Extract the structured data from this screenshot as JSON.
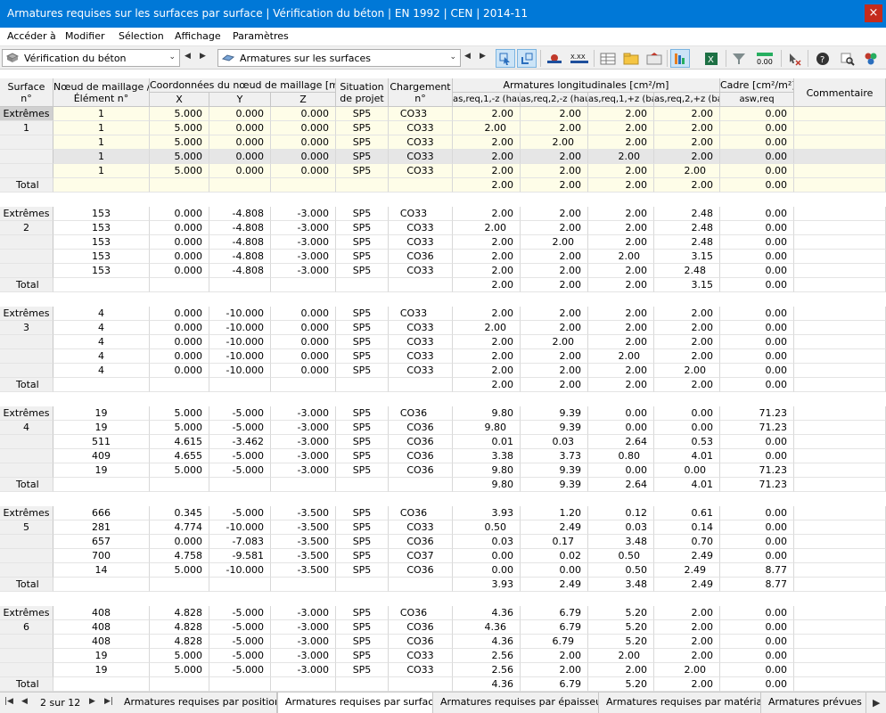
{
  "window": {
    "title": "Armatures requises sur les surfaces par surface | Vérification du béton | EN 1992 | CEN | 2014-11",
    "close": "×"
  },
  "menu": [
    "Accéder à",
    "Modifier",
    "Sélection",
    "Affichage",
    "Paramètres"
  ],
  "toolbar": {
    "module": "Vérification du béton",
    "result": "Armatures sur les surfaces",
    "prev": "◀",
    "next": "▶",
    "dropdown": "⌄",
    "xxx": "X.XX",
    "zero": "0.00"
  },
  "columns": {
    "surface": [
      "Surface",
      "n°"
    ],
    "node": [
      "Nœud de maillage /",
      "Élément n°"
    ],
    "coords_group": "Coordonnées du nœud de maillage [m]",
    "x": "X",
    "y": "Y",
    "z": "Z",
    "situation": [
      "Situation",
      "de projet"
    ],
    "loading": [
      "Chargement",
      "n°"
    ],
    "long_group": "Armatures longitudinales [cm²/m]",
    "a1": "as,req,1,-z (haut)",
    "a2": "as,req,2,-z (haut)",
    "a3": "as,req,1,+z (bas)",
    "a4": "as,req,2,+z (bas)",
    "stirrup_group": "Cadre [cm²/m²]",
    "asw": "asw,req",
    "comment": "Commentaire"
  },
  "labels": {
    "extremes": "Extrêmes",
    "total": "Total"
  },
  "groups": [
    {
      "surface": "1",
      "rows": [
        [
          "1",
          "5.000",
          "0.000",
          "0.000",
          "SP5",
          "CO33",
          "2.00",
          "2.00",
          "2.00",
          "2.00",
          "0.00"
        ],
        [
          "1",
          "5.000",
          "0.000",
          "0.000",
          "SP5",
          "CO33",
          "2.00",
          "2.00",
          "2.00",
          "2.00",
          "0.00"
        ],
        [
          "1",
          "5.000",
          "0.000",
          "0.000",
          "SP5",
          "CO33",
          "2.00",
          "2.00",
          "2.00",
          "2.00",
          "0.00"
        ],
        [
          "1",
          "5.000",
          "0.000",
          "0.000",
          "SP5",
          "CO33",
          "2.00",
          "2.00",
          "2.00",
          "2.00",
          "0.00"
        ],
        [
          "1",
          "5.000",
          "0.000",
          "0.000",
          "SP5",
          "CO33",
          "2.00",
          "2.00",
          "2.00",
          "2.00",
          "0.00"
        ]
      ],
      "total": [
        "2.00",
        "2.00",
        "2.00",
        "2.00",
        "0.00"
      ]
    },
    {
      "surface": "2",
      "rows": [
        [
          "153",
          "0.000",
          "-4.808",
          "-3.000",
          "SP5",
          "CO33",
          "2.00",
          "2.00",
          "2.00",
          "2.48",
          "0.00"
        ],
        [
          "153",
          "0.000",
          "-4.808",
          "-3.000",
          "SP5",
          "CO33",
          "2.00",
          "2.00",
          "2.00",
          "2.48",
          "0.00"
        ],
        [
          "153",
          "0.000",
          "-4.808",
          "-3.000",
          "SP5",
          "CO33",
          "2.00",
          "2.00",
          "2.00",
          "2.48",
          "0.00"
        ],
        [
          "153",
          "0.000",
          "-4.808",
          "-3.000",
          "SP5",
          "CO36",
          "2.00",
          "2.00",
          "2.00",
          "3.15",
          "0.00"
        ],
        [
          "153",
          "0.000",
          "-4.808",
          "-3.000",
          "SP5",
          "CO33",
          "2.00",
          "2.00",
          "2.00",
          "2.48",
          "0.00"
        ]
      ],
      "total": [
        "2.00",
        "2.00",
        "2.00",
        "3.15",
        "0.00"
      ]
    },
    {
      "surface": "3",
      "rows": [
        [
          "4",
          "0.000",
          "-10.000",
          "0.000",
          "SP5",
          "CO33",
          "2.00",
          "2.00",
          "2.00",
          "2.00",
          "0.00"
        ],
        [
          "4",
          "0.000",
          "-10.000",
          "0.000",
          "SP5",
          "CO33",
          "2.00",
          "2.00",
          "2.00",
          "2.00",
          "0.00"
        ],
        [
          "4",
          "0.000",
          "-10.000",
          "0.000",
          "SP5",
          "CO33",
          "2.00",
          "2.00",
          "2.00",
          "2.00",
          "0.00"
        ],
        [
          "4",
          "0.000",
          "-10.000",
          "0.000",
          "SP5",
          "CO33",
          "2.00",
          "2.00",
          "2.00",
          "2.00",
          "0.00"
        ],
        [
          "4",
          "0.000",
          "-10.000",
          "0.000",
          "SP5",
          "CO33",
          "2.00",
          "2.00",
          "2.00",
          "2.00",
          "0.00"
        ]
      ],
      "total": [
        "2.00",
        "2.00",
        "2.00",
        "2.00",
        "0.00"
      ]
    },
    {
      "surface": "4",
      "rows": [
        [
          "19",
          "5.000",
          "-5.000",
          "-3.000",
          "SP5",
          "CO36",
          "9.80",
          "9.39",
          "0.00",
          "0.00",
          "71.23"
        ],
        [
          "19",
          "5.000",
          "-5.000",
          "-3.000",
          "SP5",
          "CO36",
          "9.80",
          "9.39",
          "0.00",
          "0.00",
          "71.23"
        ],
        [
          "511",
          "4.615",
          "-3.462",
          "-3.000",
          "SP5",
          "CO36",
          "0.01",
          "0.03",
          "2.64",
          "0.53",
          "0.00"
        ],
        [
          "409",
          "4.655",
          "-5.000",
          "-3.000",
          "SP5",
          "CO36",
          "3.38",
          "3.73",
          "0.80",
          "4.01",
          "0.00"
        ],
        [
          "19",
          "5.000",
          "-5.000",
          "-3.000",
          "SP5",
          "CO36",
          "9.80",
          "9.39",
          "0.00",
          "0.00",
          "71.23"
        ]
      ],
      "total": [
        "9.80",
        "9.39",
        "2.64",
        "4.01",
        "71.23"
      ]
    },
    {
      "surface": "5",
      "rows": [
        [
          "666",
          "0.345",
          "-5.000",
          "-3.500",
          "SP5",
          "CO36",
          "3.93",
          "1.20",
          "0.12",
          "0.61",
          "0.00"
        ],
        [
          "281",
          "4.774",
          "-10.000",
          "-3.500",
          "SP5",
          "CO33",
          "0.50",
          "2.49",
          "0.03",
          "0.14",
          "0.00"
        ],
        [
          "657",
          "0.000",
          "-7.083",
          "-3.500",
          "SP5",
          "CO36",
          "0.03",
          "0.17",
          "3.48",
          "0.70",
          "0.00"
        ],
        [
          "700",
          "4.758",
          "-9.581",
          "-3.500",
          "SP5",
          "CO37",
          "0.00",
          "0.02",
          "0.50",
          "2.49",
          "0.00"
        ],
        [
          "14",
          "5.000",
          "-10.000",
          "-3.500",
          "SP5",
          "CO36",
          "0.00",
          "0.00",
          "0.50",
          "2.49",
          "8.77"
        ]
      ],
      "total": [
        "3.93",
        "2.49",
        "3.48",
        "2.49",
        "8.77"
      ]
    },
    {
      "surface": "6",
      "rows": [
        [
          "408",
          "4.828",
          "-5.000",
          "-3.000",
          "SP5",
          "CO36",
          "4.36",
          "6.79",
          "5.20",
          "2.00",
          "0.00"
        ],
        [
          "408",
          "4.828",
          "-5.000",
          "-3.000",
          "SP5",
          "CO36",
          "4.36",
          "6.79",
          "5.20",
          "2.00",
          "0.00"
        ],
        [
          "408",
          "4.828",
          "-5.000",
          "-3.000",
          "SP5",
          "CO36",
          "4.36",
          "6.79",
          "5.20",
          "2.00",
          "0.00"
        ],
        [
          "19",
          "5.000",
          "-5.000",
          "-3.000",
          "SP5",
          "CO33",
          "2.56",
          "2.00",
          "2.00",
          "2.00",
          "0.00"
        ],
        [
          "19",
          "5.000",
          "-5.000",
          "-3.000",
          "SP5",
          "CO33",
          "2.56",
          "2.00",
          "2.00",
          "2.00",
          "0.00"
        ]
      ],
      "total": [
        "4.36",
        "6.79",
        "5.20",
        "2.00",
        "0.00"
      ]
    }
  ],
  "footer": {
    "page": "2 sur 12",
    "nav": [
      "|◀",
      "◀",
      "▶",
      "▶|"
    ],
    "tabs": [
      "Armatures requises par position",
      "Armatures requises par surface",
      "Armatures requises par épaisseur",
      "Armatures requises par matériau",
      "Armatures prévues p"
    ],
    "scroll": "▶"
  },
  "colors": {
    "titlebar": "#0078d7",
    "marker": "#4a4ae0",
    "highlight_row": "#fefde8",
    "selected_row": "#e6e6e6"
  }
}
